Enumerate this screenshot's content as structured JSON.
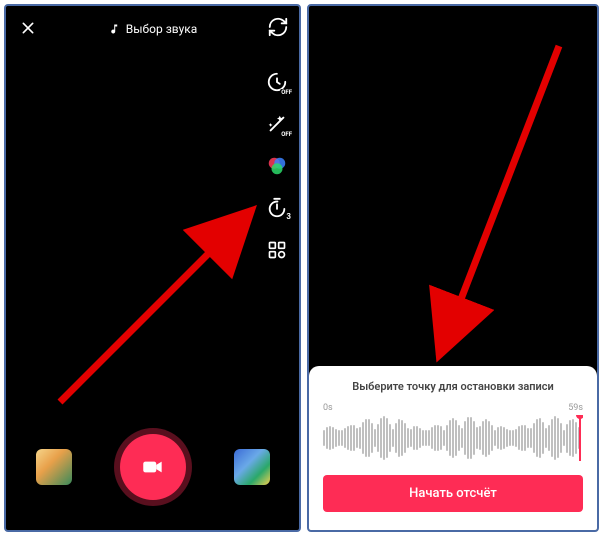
{
  "left": {
    "sound_label": "Выбор звука",
    "sidebar": {
      "speed_badge": "OFF",
      "beauty_badge": "OFF",
      "timer_badge": "3"
    }
  },
  "right": {
    "sheet_title": "Выберите точку для остановки записи",
    "time_start": "0s",
    "time_end": "59s",
    "start_button": "Начать отсчёт"
  }
}
